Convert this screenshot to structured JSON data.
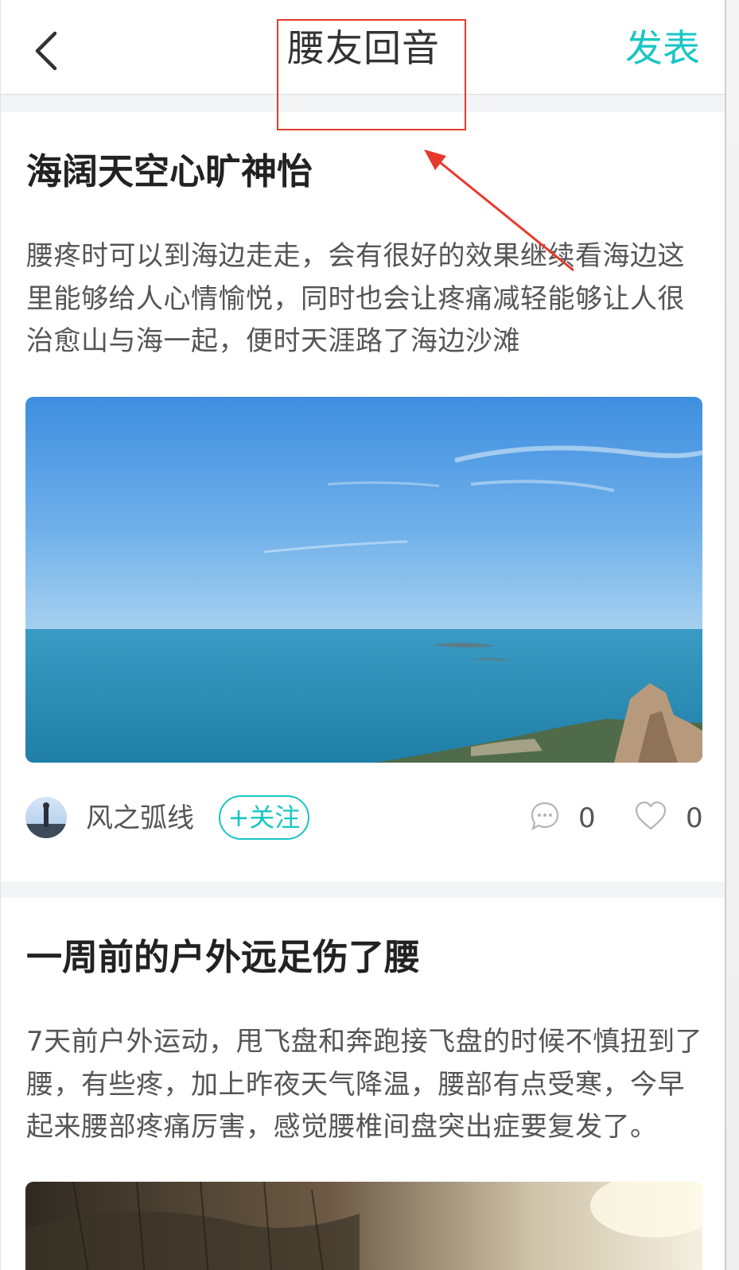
{
  "header": {
    "back_icon": "chevron-left-icon",
    "title": "腰友回音",
    "publish_label": "发表",
    "accent_color": "#19c6c3"
  },
  "annotation": {
    "color": "#e8392d"
  },
  "posts": [
    {
      "title": "海阔天空心旷神怡",
      "body": "腰疼时可以到海边走走，会有很好的效果继续看海边这里能够给人心情愉悦，同时也会让疼痛减轻能够让人很治愈山与海一起，便时天涯路了海边沙滩",
      "image": "sea-coast-photo",
      "author": "风之弧线",
      "follow_label": "+关注",
      "comment_count": "0",
      "like_count": "0"
    },
    {
      "title": "一周前的户外远足伤了腰",
      "body": "7天前户外运动，甩飞盘和奔跑接飞盘的时候不慎扭到了腰，有些疼，加上昨夜天气降温，腰部有点受寒，今早起来腰部疼痛厉害，感觉腰椎间盘突出症要复发了。",
      "image": "outdoor-hike-photo"
    }
  ]
}
